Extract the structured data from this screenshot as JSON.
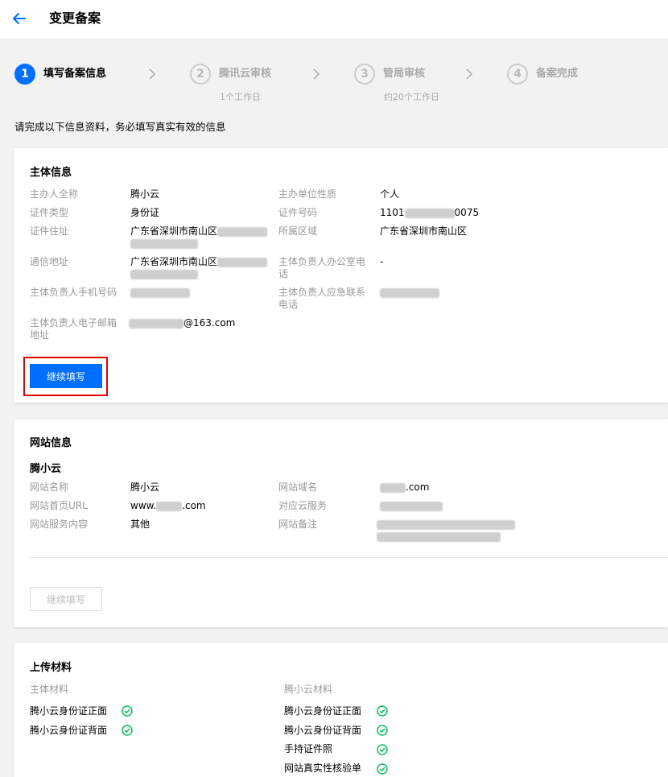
{
  "header": {
    "title": "变更备案"
  },
  "steps": [
    {
      "num": "1",
      "label": "填写备案信息",
      "sub": ""
    },
    {
      "num": "2",
      "label": "腾讯云审核",
      "sub": "1个工作日"
    },
    {
      "num": "3",
      "label": "管局审核",
      "sub": "约20个工作日"
    },
    {
      "num": "4",
      "label": "备案完成",
      "sub": ""
    }
  ],
  "intro": "请完成以下信息资料，务必填写真实有效的信息",
  "subject": {
    "title": "主体信息",
    "owner_name_label": "主办人全称",
    "owner_name": "腾小云",
    "unit_nature_label": "主办单位性质",
    "unit_nature": "个人",
    "id_type_label": "证件类型",
    "id_type": "身份证",
    "id_number_label": "证件号码",
    "id_number_prefix": "1101",
    "id_number_suffix": "0075",
    "id_address_label": "证件住址",
    "id_address_prefix": "广东省深圳市南山区",
    "region_label": "所属区域",
    "region": "广东省深圳市南山区",
    "mail_address_label": "通信地址",
    "mail_address_prefix": "广东省深圳市南山区",
    "office_phone_label_1": "主体负责人办公室电",
    "office_phone_label_2": "话",
    "office_phone": "-",
    "mobile_label": "主体负责人手机号码",
    "emergency_label_1": "主体负责人应急联系",
    "emergency_label_2": "电话",
    "email_label_1": "主体负责人电子邮箱",
    "email_label_2": "地址",
    "email_suffix": "@163.com",
    "continue": "继续填写"
  },
  "website": {
    "title": "网站信息",
    "site_title": "腾小云",
    "name_label": "网站名称",
    "name": "腾小云",
    "domain_label": "网站域名",
    "domain_suffix": ".com",
    "url_label": "网站首页URL",
    "url_prefix": "www.",
    "url_suffix": ".com",
    "cloud_label": "对应云服务",
    "content_label": "网站服务内容",
    "content": "其他",
    "note_label": "网站备注",
    "continue": "继续填写"
  },
  "materials": {
    "title": "上传材料",
    "left_heading": "主体材料",
    "left_items": [
      "腾小云身份证正面",
      "腾小云身份证背面"
    ],
    "right_heading": "腾小云材料",
    "right_items": [
      "腾小云身份证正面",
      "腾小云身份证背面",
      "手持证件照",
      "网站真实性核验单"
    ]
  },
  "colors": {
    "primary": "#006eff",
    "highlight": "#e30000",
    "success": "#0abf5b"
  }
}
